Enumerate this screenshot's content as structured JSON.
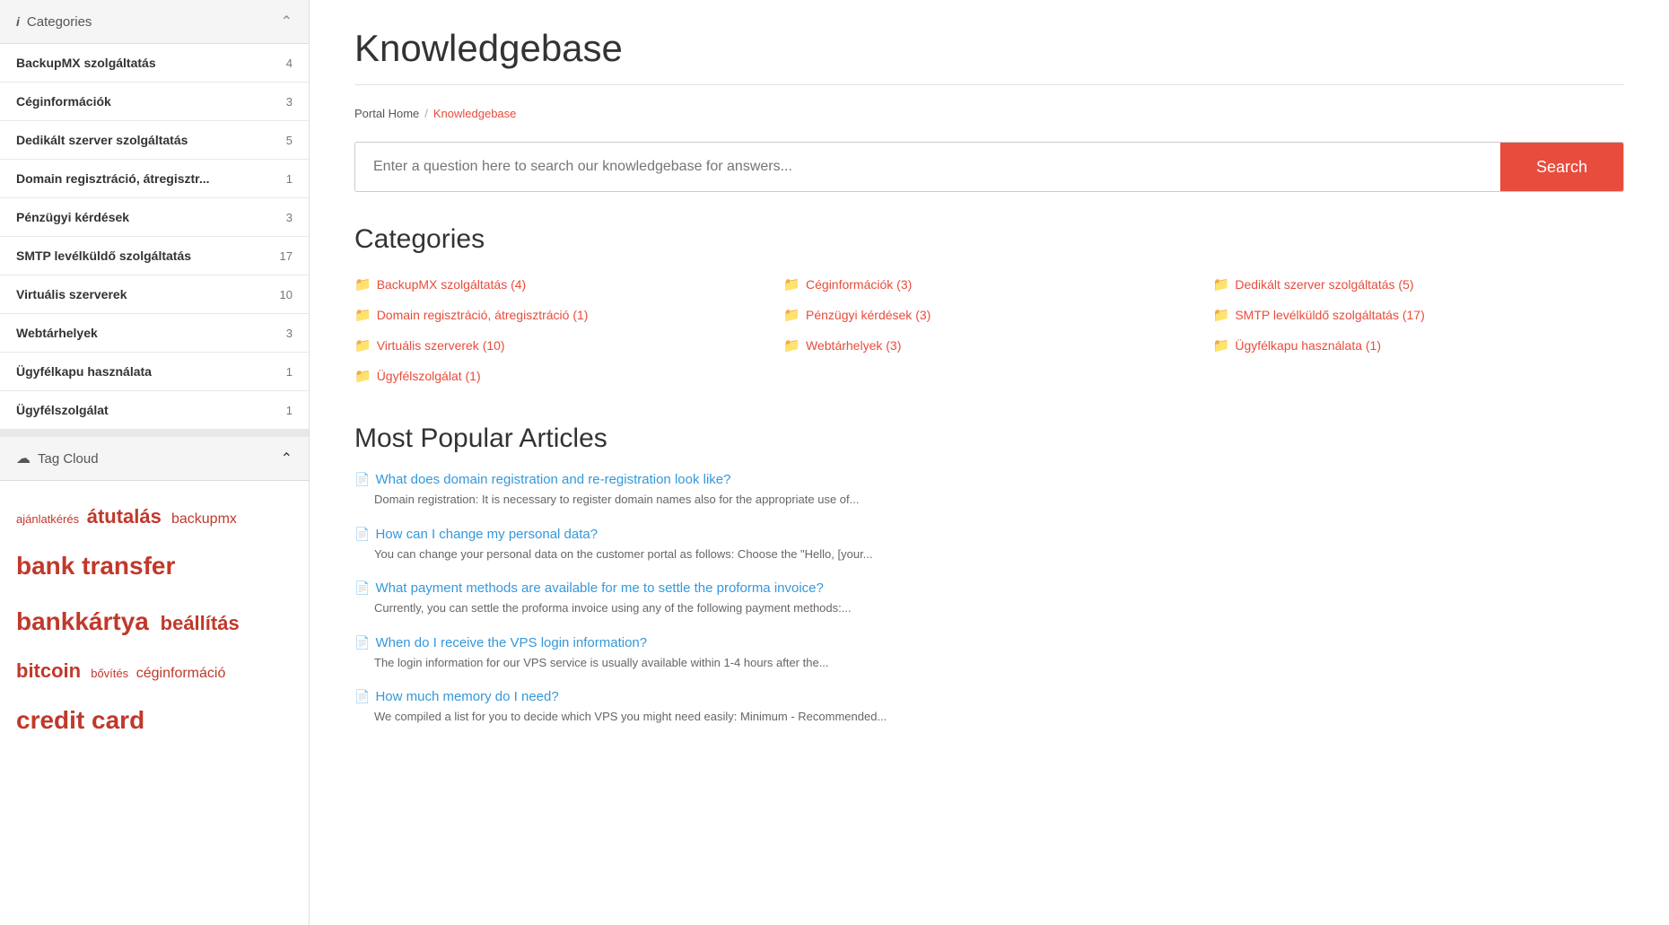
{
  "sidebar": {
    "categories_header": "Categories",
    "categories": [
      {
        "label": "BackupMX szolgáltatás",
        "count": 4
      },
      {
        "label": "Céginformációk",
        "count": 3
      },
      {
        "label": "Dedikált szerver szolgáltatás",
        "count": 5
      },
      {
        "label": "Domain regisztráció, átregisztr...",
        "count": 1
      },
      {
        "label": "Pénzügyi kérdések",
        "count": 3
      },
      {
        "label": "SMTP levélküldő szolgáltatás",
        "count": 17
      },
      {
        "label": "Virtuális szerverek",
        "count": 10
      },
      {
        "label": "Webtárhelyek",
        "count": 3
      },
      {
        "label": "Ügyfélkapu használata",
        "count": 1
      },
      {
        "label": "Ügyfélszolgálat",
        "count": 1
      }
    ],
    "tagcloud_header": "Tag Cloud",
    "tags": [
      {
        "text": "ajánlatkérés",
        "size": "sm"
      },
      {
        "text": "átutalás",
        "size": "lg"
      },
      {
        "text": "backupmx",
        "size": "md"
      },
      {
        "text": "bank transfer",
        "size": "xl"
      },
      {
        "text": "bankkártya",
        "size": "xl"
      },
      {
        "text": "beállítás",
        "size": "lg"
      },
      {
        "text": "bitcoin",
        "size": "lg"
      },
      {
        "text": "bővítés",
        "size": "sm"
      },
      {
        "text": "céginformáció",
        "size": "md"
      },
      {
        "text": "credit card",
        "size": "xl"
      }
    ]
  },
  "main": {
    "page_title": "Knowledgebase",
    "breadcrumb_home": "Portal Home",
    "breadcrumb_sep": "/",
    "breadcrumb_current": "Knowledgebase",
    "search_placeholder": "Enter a question here to search our knowledgebase for answers...",
    "search_button": "Search",
    "categories_heading": "Categories",
    "categories": [
      {
        "label": "BackupMX szolgáltatás (4)",
        "col": 0
      },
      {
        "label": "Céginformációk (3)",
        "col": 1
      },
      {
        "label": "Dedikált szerver szolgáltatás (5)",
        "col": 2
      },
      {
        "label": "Domain regisztráció, átregisztráció (1)",
        "col": 0
      },
      {
        "label": "Pénzügyi kérdések (3)",
        "col": 1
      },
      {
        "label": "SMTP levélküldő szolgáltatás (17)",
        "col": 2
      },
      {
        "label": "Virtuális szerverek (10)",
        "col": 0
      },
      {
        "label": "Webtárhelyek (3)",
        "col": 1
      },
      {
        "label": "Ügyfélkapu használata (1)",
        "col": 2
      },
      {
        "label": "Ügyfélszolgálat (1)",
        "col": 0
      }
    ],
    "popular_heading": "Most Popular Articles",
    "articles": [
      {
        "title": "What does domain registration and re-registration look like?",
        "excerpt": "Domain registration: It is necessary to register domain names also for the appropriate use of..."
      },
      {
        "title": "How can I change my personal data?",
        "excerpt": "You can change your personal data on the customer portal as follows: Choose the \"Hello, [your..."
      },
      {
        "title": "What payment methods are available for me to settle the proforma invoice?",
        "excerpt": "Currently, you can settle the proforma invoice using any of the following payment methods:..."
      },
      {
        "title": "When do I receive the VPS login information?",
        "excerpt": "The login information for our VPS service is usually available within 1-4 hours after the..."
      },
      {
        "title": "How much memory do I need?",
        "excerpt": "We compiled a list for you to decide which VPS you might need easily: Minimum - Recommended..."
      }
    ]
  }
}
